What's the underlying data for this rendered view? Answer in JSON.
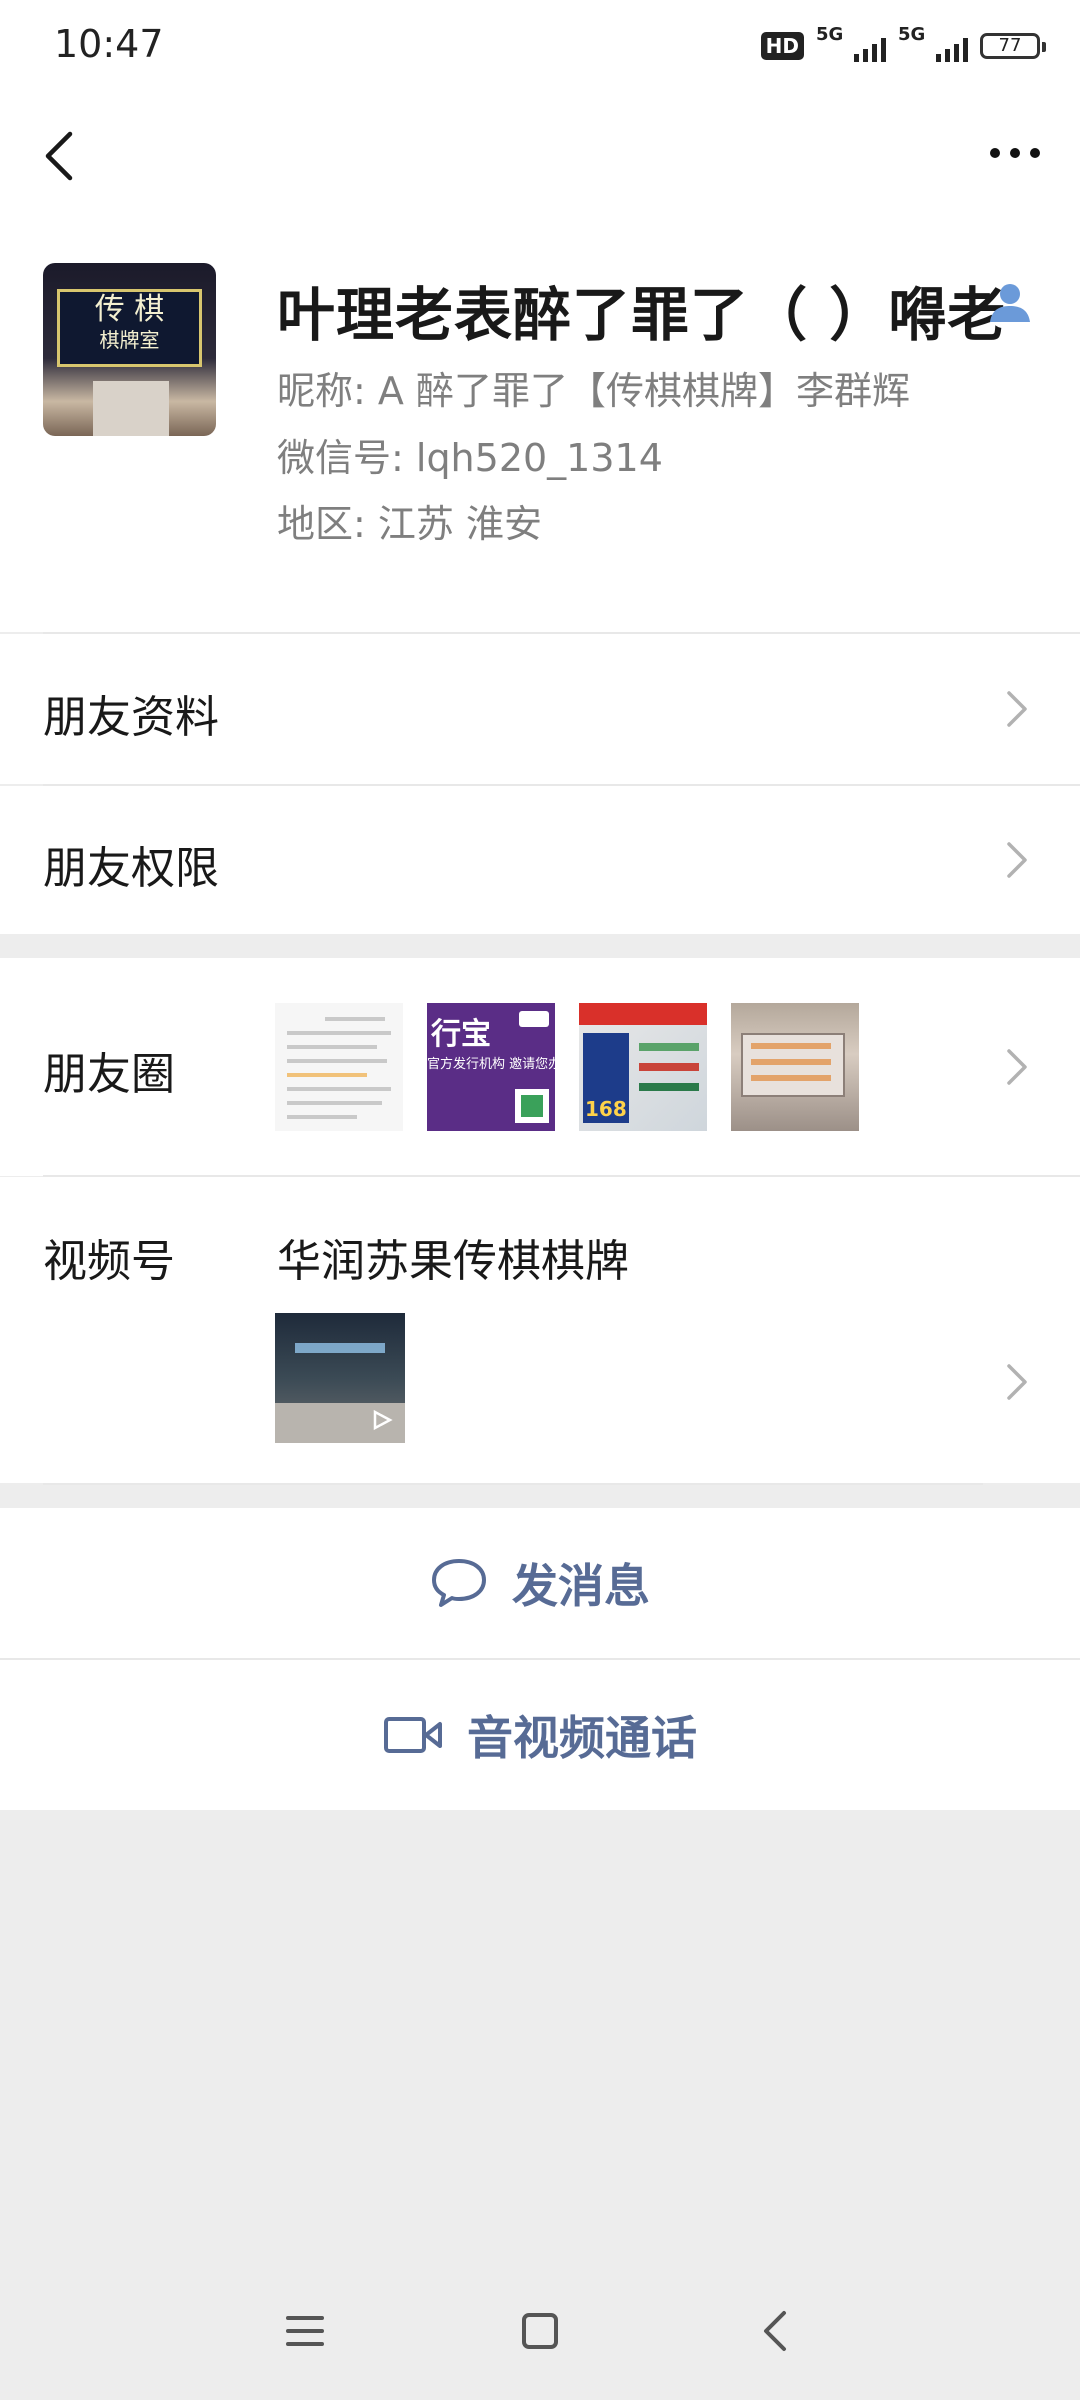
{
  "status_bar": {
    "time": "10:47",
    "hd_label": "HD",
    "network_1": "5G",
    "network_2": "5G",
    "battery": "77"
  },
  "profile": {
    "display_name": "叶理老表醉了罪了（ ）嘚老",
    "nickname_line": "昵称:  A  醉了罪了【传棋棋牌】李群辉",
    "wechat_id_line": "微信号:  lqh520_1314",
    "region_line": "地区:  江苏  淮安",
    "avatar_sign_text": "传 棋",
    "avatar_sign_sub": "棋牌室"
  },
  "rows": {
    "friend_info": "朋友资料",
    "friend_permissions": "朋友权限",
    "moments": "朋友圈",
    "channels": "视频号",
    "channels_name": "华润苏果传棋棋牌"
  },
  "moments_thumbs": {
    "t2_text_a": "行宝",
    "t2_text_b": "官方发行机构  邀请您办理",
    "t3_text": "168"
  },
  "actions": {
    "send_message": "发消息",
    "video_call": "音视频通话"
  },
  "colors": {
    "link_blue": "#576b95",
    "background": "#ededed",
    "divider": "#e8e8e8"
  }
}
